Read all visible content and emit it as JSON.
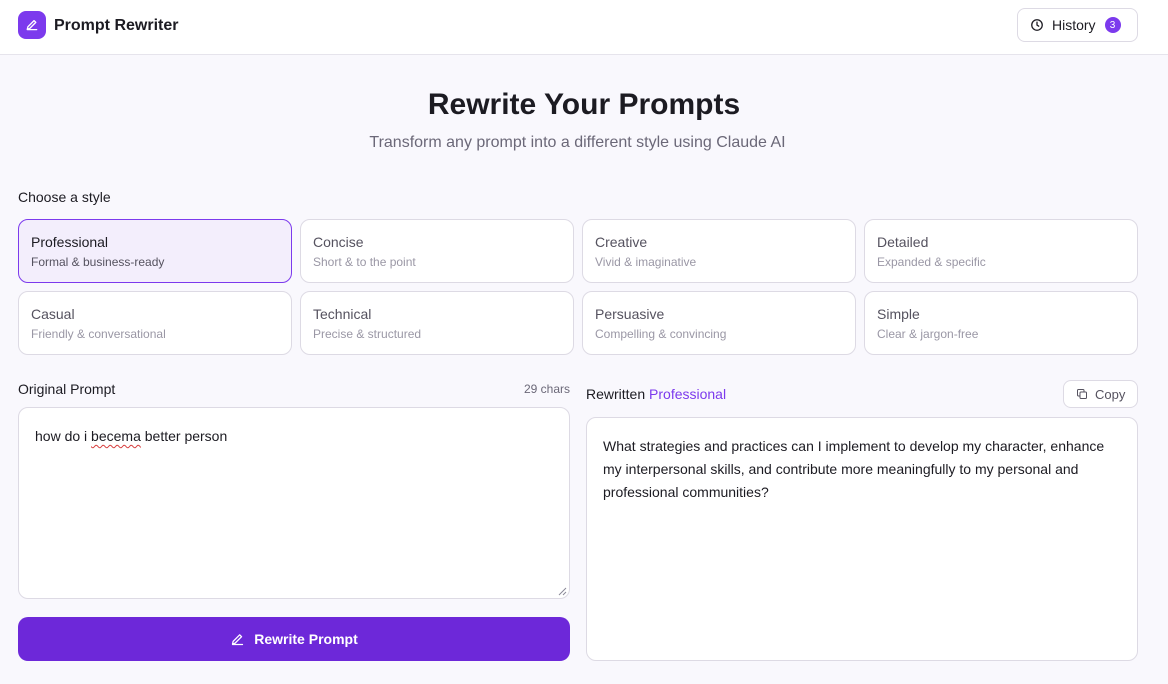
{
  "header": {
    "app_title": "Prompt Rewriter",
    "logo_icon": "pencil-icon",
    "history_label": "History",
    "history_icon": "clock-icon",
    "history_count": "3"
  },
  "hero": {
    "title": "Rewrite Your Prompts",
    "subtitle": "Transform any prompt into a different style using Claude AI"
  },
  "styles": {
    "label": "Choose a style",
    "selected": "Professional",
    "items": [
      {
        "name": "Professional",
        "desc": "Formal & business-ready"
      },
      {
        "name": "Concise",
        "desc": "Short & to the point"
      },
      {
        "name": "Creative",
        "desc": "Vivid & imaginative"
      },
      {
        "name": "Detailed",
        "desc": "Expanded & specific"
      },
      {
        "name": "Casual",
        "desc": "Friendly & conversational"
      },
      {
        "name": "Technical",
        "desc": "Precise & structured"
      },
      {
        "name": "Persuasive",
        "desc": "Compelling & convincing"
      },
      {
        "name": "Simple",
        "desc": "Clear & jargon-free"
      }
    ]
  },
  "input": {
    "label": "Original Prompt",
    "char_count": "29 chars",
    "text_before": "how do i ",
    "text_misspelled": "becema",
    "text_after": " better person"
  },
  "rewrite_button": {
    "label": "Rewrite Prompt",
    "icon": "pencil-icon"
  },
  "output": {
    "label_prefix": "Rewritten",
    "style_name": "Professional",
    "copy_label": "Copy",
    "copy_icon": "copy-icon",
    "text": "What strategies and practices can I implement to develop my character, enhance my interpersonal skills, and contribute more meaningfully to my personal and professional communities?"
  },
  "colors": {
    "accent": "#7c3aed",
    "button": "#6d28d9",
    "background": "#f9f8fd"
  }
}
